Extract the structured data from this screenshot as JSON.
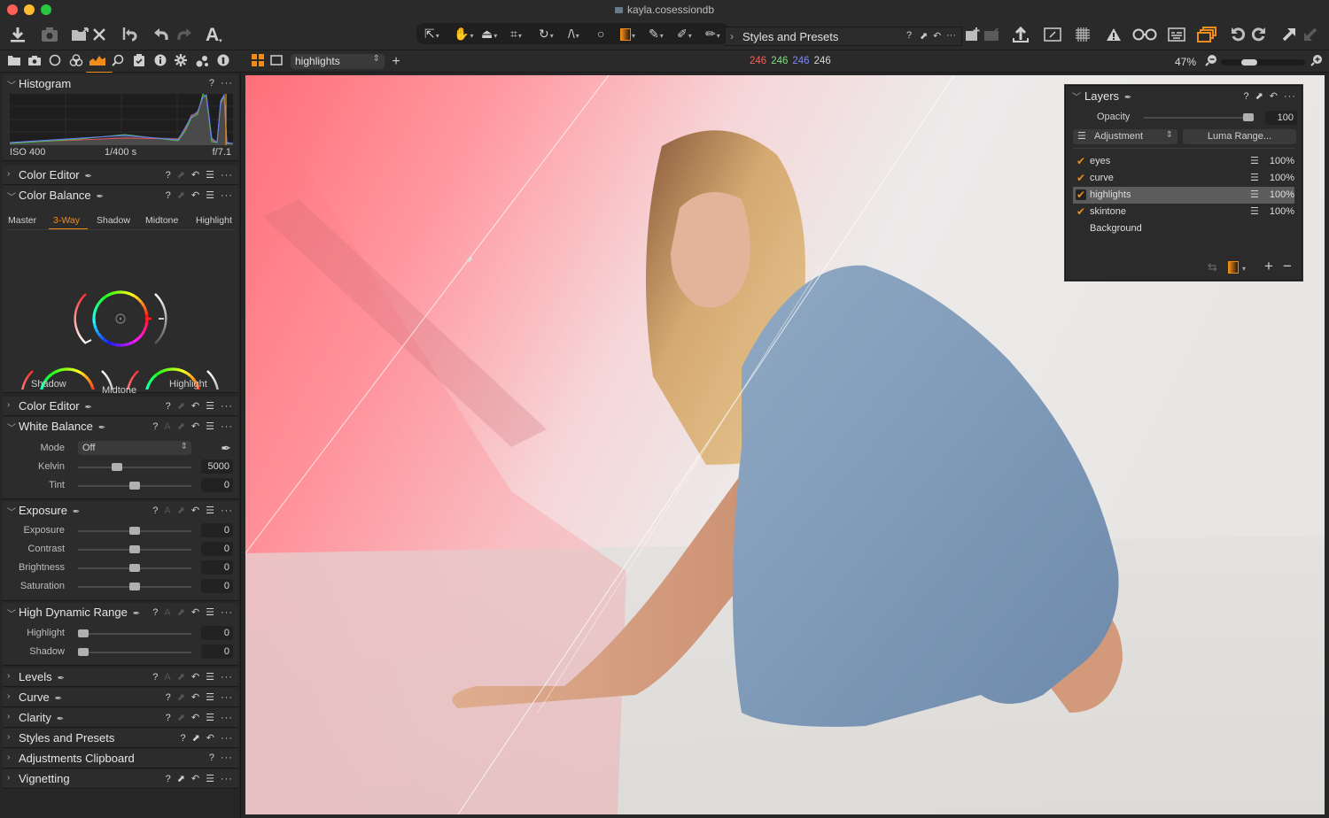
{
  "window": {
    "title": "kayla.cosessiondb",
    "traffic_lights": {
      "close": "#fe5f57",
      "minimize": "#febc2e",
      "zoom": "#28c840"
    }
  },
  "colors": {
    "accent": "#f08c1a",
    "panel_bg": "#2c2c2c",
    "toolbar_bg": "#2a2a2a"
  },
  "toolbar": {
    "left_icons": [
      "import-icon",
      "camera-capture-icon",
      "move-to-folder-icon",
      "delete-icon",
      "reset-icon",
      "undo-icon",
      "redo-icon",
      "text-annotation-icon"
    ],
    "cursor_tools": [
      "select-cursor-icon",
      "pan-hand-icon",
      "keystone-icon",
      "crop-icon",
      "rotate-icon",
      "straighten-icon",
      "spot-removal-icon",
      "gradient-mask-icon",
      "draw-mask-icon",
      "erase-mask-icon",
      "pick-color-icon"
    ],
    "right_icons": [
      "new-variant-icon",
      "select-variants-icon",
      "export-icon",
      "edit-icon",
      "grid-icon",
      "exposure-warning-icon",
      "loupe-icon",
      "proof-icon",
      "multi-view-icon",
      "rotate-left-icon",
      "rotate-right-icon",
      "copy-adjustments-icon",
      "apply-adjustments-icon"
    ]
  },
  "styles_popover": {
    "label": "Styles and Presets",
    "help": "?"
  },
  "tool_tabs": [
    "library-tab",
    "capture-tab",
    "lens-tab",
    "color-tab",
    "exposure-tab",
    "details-tab",
    "adjustments-tab",
    "metadata-tab",
    "output-tab",
    "batch-tab",
    "info-tab"
  ],
  "viewer": {
    "layer_select": "highlights",
    "rgb": {
      "r": "246",
      "g": "246",
      "b": "246",
      "l": "246",
      "r_color": "#ff5a5a",
      "g_color": "#7ee07e",
      "b_color": "#7a8cff"
    },
    "zoom": "47%",
    "zoom_fraction": 0.3
  },
  "histogram": {
    "title": "Histogram",
    "iso": "ISO 400",
    "shutter": "1/400 s",
    "aperture": "f/7.1"
  },
  "sections": {
    "color_editor_1": {
      "title": "Color Editor"
    },
    "color_balance": {
      "title": "Color Balance",
      "tabs": [
        "Master",
        "3-Way",
        "Shadow",
        "Midtone",
        "Highlight"
      ],
      "active_tab": "3-Way",
      "wheels": {
        "shadow": "Shadow",
        "midtone": "Midtone",
        "highlight": "Highlight"
      }
    },
    "color_editor_2": {
      "title": "Color Editor"
    },
    "white_balance": {
      "title": "White Balance",
      "mode_label": "Mode",
      "mode_value": "Off",
      "kelvin_label": "Kelvin",
      "kelvin_value": "5000",
      "kelvin_fraction": 0.33,
      "tint_label": "Tint",
      "tint_value": "0",
      "tint_fraction": 0.5
    },
    "exposure": {
      "title": "Exposure",
      "sliders": [
        {
          "label": "Exposure",
          "value": "0",
          "fraction": 0.5
        },
        {
          "label": "Contrast",
          "value": "0",
          "fraction": 0.5
        },
        {
          "label": "Brightness",
          "value": "0",
          "fraction": 0.5
        },
        {
          "label": "Saturation",
          "value": "0",
          "fraction": 0.5
        }
      ]
    },
    "hdr": {
      "title": "High Dynamic Range",
      "sliders": [
        {
          "label": "Highlight",
          "value": "0",
          "fraction": 0.0
        },
        {
          "label": "Shadow",
          "value": "0",
          "fraction": 0.0
        }
      ]
    },
    "levels": {
      "title": "Levels"
    },
    "curve": {
      "title": "Curve"
    },
    "clarity": {
      "title": "Clarity"
    },
    "styles": {
      "title": "Styles and Presets"
    },
    "clipboard": {
      "title": "Adjustments Clipboard"
    },
    "vignetting": {
      "title": "Vignetting"
    }
  },
  "layers_panel": {
    "title": "Layers",
    "opacity_label": "Opacity",
    "opacity_value": "100",
    "opacity_fraction": 1.0,
    "type_select": "Adjustment",
    "luma_button": "Luma Range...",
    "layers": [
      {
        "name": "eyes",
        "checked": true,
        "opacity": "100%",
        "selected": false
      },
      {
        "name": "curve",
        "checked": true,
        "opacity": "100%",
        "selected": false
      },
      {
        "name": "highlights",
        "checked": true,
        "opacity": "100%",
        "selected": true
      },
      {
        "name": "skintone",
        "checked": true,
        "opacity": "100%",
        "selected": false
      },
      {
        "name": "Background",
        "checked": false,
        "opacity": "",
        "selected": false
      }
    ]
  },
  "common": {
    "help": "?",
    "more": "···",
    "auto": "A"
  }
}
